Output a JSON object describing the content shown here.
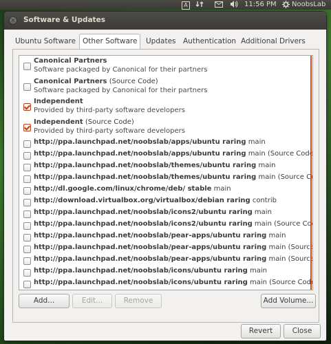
{
  "topbar": {
    "kbd": "A",
    "time": "11:56 PM",
    "user": "NoobsLab"
  },
  "window": {
    "title": "Software & Updates",
    "tabs": [
      {
        "label": "Ubuntu Software"
      },
      {
        "label": "Other Software"
      },
      {
        "label": "Updates"
      },
      {
        "label": "Authentication"
      },
      {
        "label": "Additional Drivers"
      }
    ],
    "active_tab": "Other Software",
    "sources": [
      {
        "title": "Canonical Partners",
        "suffix": "",
        "subtitle": "Software packaged by Canonical for their partners",
        "checked": false
      },
      {
        "title": "Canonical Partners",
        "suffix": " (Source Code)",
        "subtitle": "Software packaged by Canonical for their partners",
        "checked": false
      },
      {
        "title": "Independent",
        "suffix": "",
        "subtitle": "Provided by third-party software developers",
        "checked": true
      },
      {
        "title": "Independent",
        "suffix": " (Source Code)",
        "subtitle": "Provided by third-party software developers",
        "checked": true
      },
      {
        "title": "http://ppa.launchpad.net/noobslab/apps/ubuntu raring",
        "suffix": " main",
        "subtitle": "",
        "checked": false
      },
      {
        "title": "http://ppa.launchpad.net/noobslab/apps/ubuntu raring",
        "suffix": " main (Source Code)",
        "subtitle": "",
        "checked": false
      },
      {
        "title": "http://ppa.launchpad.net/noobslab/themes/ubuntu raring",
        "suffix": " main",
        "subtitle": "",
        "checked": false
      },
      {
        "title": "http://ppa.launchpad.net/noobslab/themes/ubuntu raring",
        "suffix": " main (Source Code)",
        "subtitle": "",
        "checked": false
      },
      {
        "title": "http://dl.google.com/linux/chrome/deb/ stable",
        "suffix": " main",
        "subtitle": "",
        "checked": false
      },
      {
        "title": "http://download.virtualbox.org/virtualbox/debian raring",
        "suffix": " contrib",
        "subtitle": "",
        "checked": false
      },
      {
        "title": "http://ppa.launchpad.net/noobslab/icons2/ubuntu raring",
        "suffix": " main",
        "subtitle": "",
        "checked": false
      },
      {
        "title": "http://ppa.launchpad.net/noobslab/icons2/ubuntu raring",
        "suffix": " main (Source Code)",
        "subtitle": "",
        "checked": false
      },
      {
        "title": "http://ppa.launchpad.net/noobslab/pear-apps/ubuntu raring",
        "suffix": " main",
        "subtitle": "",
        "checked": false
      },
      {
        "title": "http://ppa.launchpad.net/noobslab/pear-apps/ubuntu raring",
        "suffix": " main (Source Code",
        "subtitle": "",
        "checked": false
      },
      {
        "title": "http://ppa.launchpad.net/noobslab/pear-apps/ubuntu raring",
        "suffix": " main (Source Code",
        "subtitle": "",
        "checked": false
      },
      {
        "title": "http://ppa.launchpad.net/noobslab/icons/ubuntu raring",
        "suffix": " main",
        "subtitle": "",
        "checked": false
      },
      {
        "title": "http://ppa.launchpad.net/noobslab/icons/ubuntu raring",
        "suffix": " main (Source Code)",
        "subtitle": "",
        "checked": false
      }
    ],
    "buttons": {
      "add": "Add...",
      "edit": "Edit...",
      "remove": "Remove",
      "add_volume": "Add Volume...",
      "revert": "Revert",
      "close": "Close"
    }
  },
  "colors": {
    "accent": "#dd4814",
    "panel_bg": "#3c3b37"
  }
}
